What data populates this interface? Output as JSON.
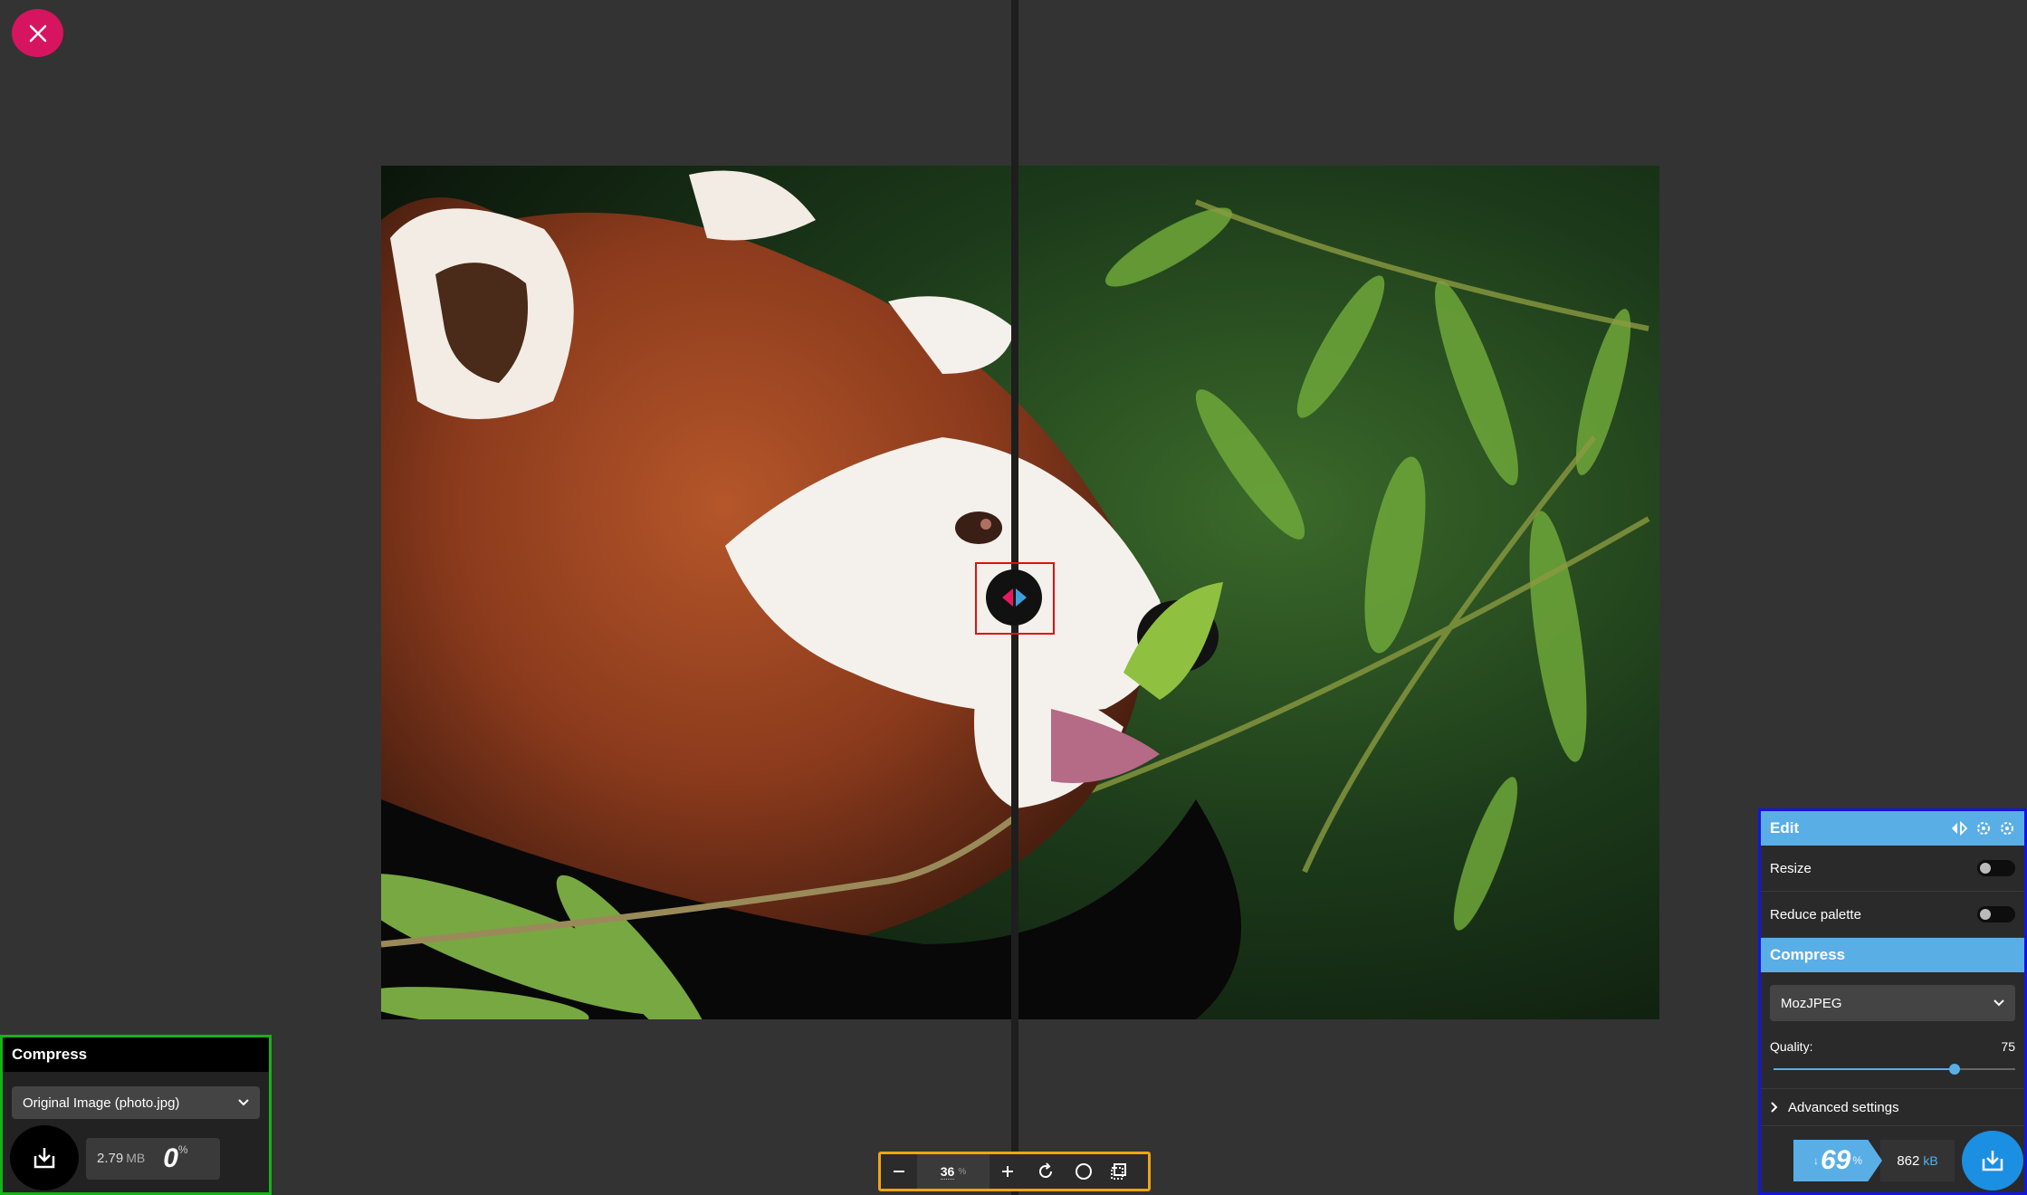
{
  "close_icon": "close-icon",
  "left_panel": {
    "title": "Compress",
    "select_value": "Original Image (photo.jpg)",
    "size_value": "2.79",
    "size_unit": "MB",
    "percent_value": "0",
    "percent_symbol": "%"
  },
  "zoom": {
    "value": "36",
    "unit": "%"
  },
  "right_panel": {
    "edit_title": "Edit",
    "resize_label": "Resize",
    "reduce_palette_label": "Reduce palette",
    "compress_title": "Compress",
    "codec_value": "MozJPEG",
    "quality_label": "Quality:",
    "quality_value": "75",
    "quality_fraction": 0.75,
    "advanced_label": "Advanced settings",
    "savings_arrow": "↓",
    "savings_value": "69",
    "savings_symbol": "%",
    "size_value": "862",
    "size_unit": "kB"
  },
  "colors": {
    "accent_blue": "#5aaee6",
    "accent_pink": "#d7145f",
    "background": "#333333"
  }
}
